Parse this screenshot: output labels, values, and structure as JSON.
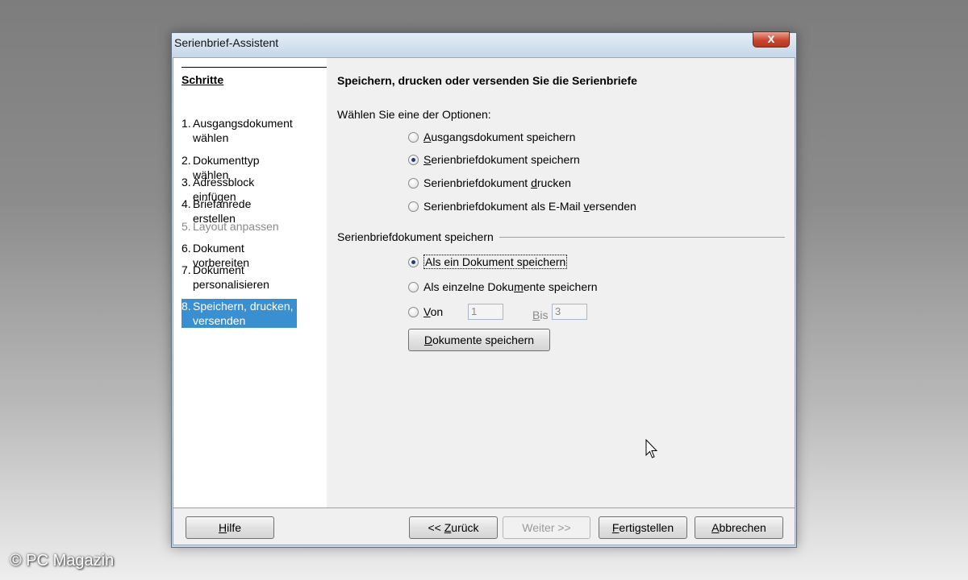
{
  "window": {
    "title": "Serienbrief-Assistent",
    "close_label": "x"
  },
  "sidebar": {
    "title": "Schritte",
    "steps": [
      {
        "num": "1.",
        "label": "Ausgangsdokument wählen"
      },
      {
        "num": "2.",
        "label": "Dokumenttyp wählen"
      },
      {
        "num": "3.",
        "label": "Adressblock einfügen"
      },
      {
        "num": "4.",
        "label": "Briefanrede erstellen"
      },
      {
        "num": "5.",
        "label": "Layout anpassen",
        "state": "disabled"
      },
      {
        "num": "6.",
        "label": "Dokument vorbereiten"
      },
      {
        "num": "7.",
        "label": "Dokument personalisieren"
      },
      {
        "num": "8.",
        "label": "Speichern, drucken, versenden",
        "state": "selected"
      }
    ]
  },
  "main": {
    "heading": "Speichern, drucken oder versenden Sie die Serienbriefe",
    "prompt": "Wählen Sie eine der Optionen:",
    "options": {
      "opt1_a": "A",
      "opt1_b": "usgangsdokument speichern",
      "opt2_a": "S",
      "opt2_b": "erienbriefdokument speichern",
      "opt3_a": "Serienbriefdokument ",
      "opt3_u": "d",
      "opt3_b": "rucken",
      "opt4_a": "Serienbriefdokument als E-Mail ",
      "opt4_u": "v",
      "opt4_b": "ersenden",
      "selected": "Serienbriefdokument speichern"
    },
    "group_label": "Serienbriefdokument speichern",
    "save_options": {
      "s1_a": "Als ein Dokument speichern",
      "s2_a": "Als einzelne Doku",
      "s2_u": "m",
      "s2_b": "ente speichern",
      "s3_a": "V",
      "s3_b": "on",
      "bis_a": "B",
      "bis_b": "is",
      "selected": "Als ein Dokument speichern"
    },
    "von_value": "1",
    "bis_value": "3",
    "save_button_a": "D",
    "save_button_b": "okumente speichern"
  },
  "footer": {
    "help_a": "H",
    "help_b": "ilfe",
    "back_a": "<< ",
    "back_u": "Z",
    "back_b": "urück",
    "next": "Weiter >>",
    "finish_a": "F",
    "finish_b": "ertigstellen",
    "cancel_a": "A",
    "cancel_b": "bbrechen"
  },
  "watermark": "© PC Magazin"
}
